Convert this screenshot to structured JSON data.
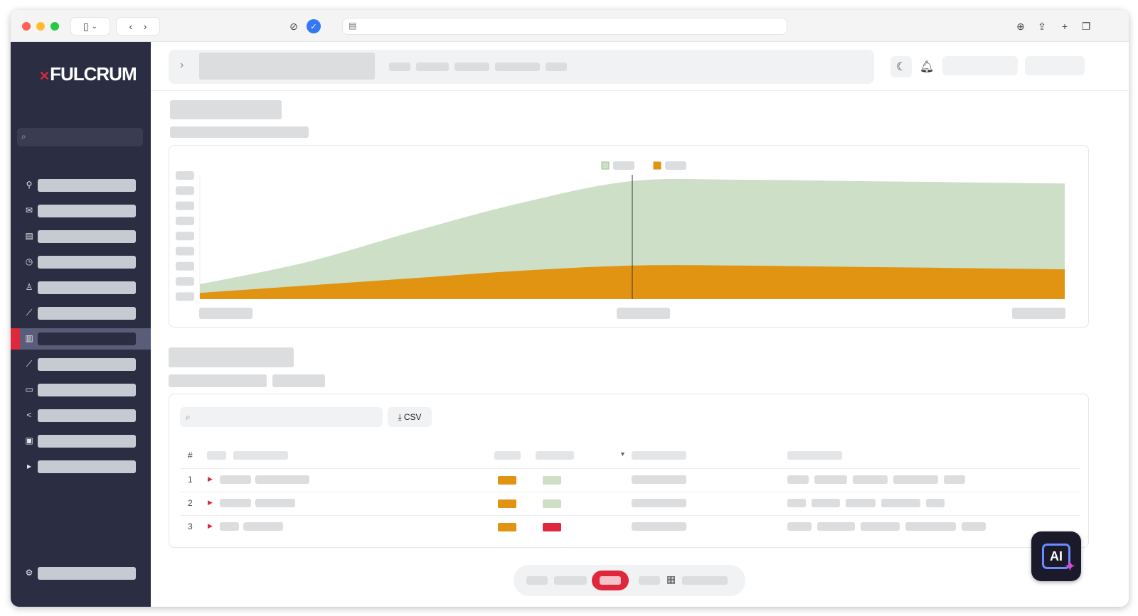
{
  "app": {
    "logo_text": "FULCRUM",
    "logo_mark": "✕"
  },
  "chrome": {
    "icons": [
      "sidebar-toggle-icon",
      "chevron-down-icon",
      "back-icon",
      "forward-icon",
      "privacy-icon",
      "shield-check-icon",
      "reader-icon",
      "download-icon",
      "share-icon",
      "new-tab-icon",
      "tabs-overview-icon"
    ]
  },
  "sidebar": {
    "search_icon": "search-icon",
    "items": [
      {
        "icon": "pin-icon",
        "glyph": "⚲"
      },
      {
        "icon": "mail-icon",
        "glyph": "✉"
      },
      {
        "icon": "chart-grid-icon",
        "glyph": "▤"
      },
      {
        "icon": "clock-icon",
        "glyph": "◷"
      },
      {
        "icon": "user-icon",
        "glyph": "♙"
      },
      {
        "icon": "line-chart-icon",
        "glyph": "⟋"
      },
      {
        "icon": "bar-chart-icon",
        "glyph": "▥",
        "active": true
      },
      {
        "icon": "trend-icon",
        "glyph": "⟋"
      },
      {
        "icon": "comment-icon",
        "glyph": "▭"
      },
      {
        "icon": "share-nodes-icon",
        "glyph": "<"
      },
      {
        "icon": "image-icon",
        "glyph": "▣"
      },
      {
        "icon": "play-icon",
        "glyph": "▸"
      }
    ],
    "footer_icon": "gear-icon"
  },
  "header": {
    "icons": [
      "chevron-right-icon",
      "moon-icon",
      "bell-icon"
    ]
  },
  "chart_data": {
    "type": "area",
    "x_points": 9,
    "series": [
      {
        "color": "#cde0c7",
        "values": [
          12,
          30,
          55,
          78,
          95,
          96,
          95,
          94,
          93
        ]
      },
      {
        "color": "#e09412",
        "values": [
          5,
          11,
          17,
          23,
          27,
          27,
          26,
          25,
          24
        ]
      }
    ],
    "ylim": [
      0,
      100
    ],
    "cursor_index": 4
  },
  "table": {
    "csv_label": "CSV",
    "header_hash": "#",
    "rows": [
      {
        "num": "1",
        "status_a": "#e09412",
        "status_b": "#cde0c7"
      },
      {
        "num": "2",
        "status_a": "#e09412",
        "status_b": "#cde0c7"
      },
      {
        "num": "3",
        "status_a": "#e09412",
        "status_b": "#e0283d"
      }
    ]
  },
  "pager": {
    "active_color": "#e0283d",
    "icon": "calendar-icon"
  },
  "ai_button": {
    "label": "AI",
    "icon": "sparkle-icon"
  },
  "colors": {
    "accent": "#e0283d",
    "sidebar_bg": "#2b2d43",
    "green": "#cde0c7",
    "orange": "#e09412"
  }
}
